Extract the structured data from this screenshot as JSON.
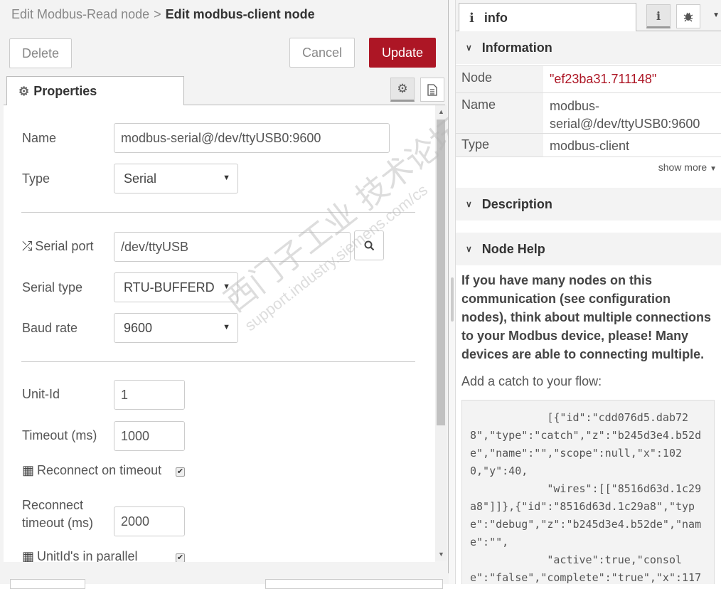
{
  "editor": {
    "breadcrumb": {
      "parent": "Edit Modbus-Read node",
      "separator": ">",
      "current": "Edit modbus-client node"
    },
    "buttons": {
      "delete": "Delete",
      "cancel": "Cancel",
      "update": "Update"
    },
    "tab": {
      "label": "Properties",
      "icon": "gear-icon"
    },
    "fields": {
      "name": {
        "label": "Name",
        "value": "modbus-serial@/dev/ttyUSB0:9600"
      },
      "type": {
        "label": "Type",
        "value": "Serial"
      },
      "serial_port": {
        "label": "Serial port",
        "value": "/dev/ttyUSB",
        "icon": "shuffle-icon"
      },
      "serial_type": {
        "label": "Serial type",
        "value": "RTU-BUFFERD"
      },
      "baud_rate": {
        "label": "Baud rate",
        "value": "9600"
      },
      "unit_id": {
        "label": "Unit-Id",
        "value": "1"
      },
      "timeout": {
        "label": "Timeout (ms)",
        "value": "1000"
      },
      "reconnect_on_timeout": {
        "label": "Reconnect on timeout",
        "checked": true,
        "icon": "grid-icon"
      },
      "reconnect_timeout": {
        "label_line1": "Reconnect",
        "label_line2": "timeout (ms)",
        "value": "2000"
      },
      "unitids_parallel": {
        "label": "UnitId's in parallel",
        "checked": true,
        "icon": "grid-icon"
      }
    }
  },
  "watermark": {
    "line1": "西门子工业 技术论坛",
    "line2": "support.industry.siemens.com/cs"
  },
  "sidebar": {
    "tab": {
      "label": "info",
      "icon": "info-icon"
    },
    "information": {
      "title": "Information",
      "rows": [
        {
          "key": "Node",
          "value": "\"ef23ba31.711148\""
        },
        {
          "key": "Name",
          "value_line1": "modbus-",
          "value_line2": "serial@/dev/ttyUSB0:9600"
        },
        {
          "key": "Type",
          "value": "modbus-client"
        }
      ],
      "show_more": "show more"
    },
    "description": {
      "title": "Description"
    },
    "node_help": {
      "title": "Node Help",
      "bold_text": "If you have many nodes on this communication (see configuration nodes), think about multiple connections to your Modbus device, please! Many devices are able to connecting multiple.",
      "text": "Add a catch to your flow:",
      "code": "            [{\"id\":\"cdd076d5.dab728\",\"type\":\"catch\",\"z\":\"b245d3e4.b52de\",\"name\":\"\",\"scope\":null,\"x\":1020,\"y\":40,\n            \"wires\":[[\"8516d63d.1c29a8\"]]},{\"id\":\"8516d63d.1c29a8\",\"type\":\"debug\",\"z\":\"b245d3e4.b52de\",\"name\":\"\",\n            \"active\":true,\"console\":\"false\",\"complete\":\"true\",\"x\":117"
    }
  }
}
